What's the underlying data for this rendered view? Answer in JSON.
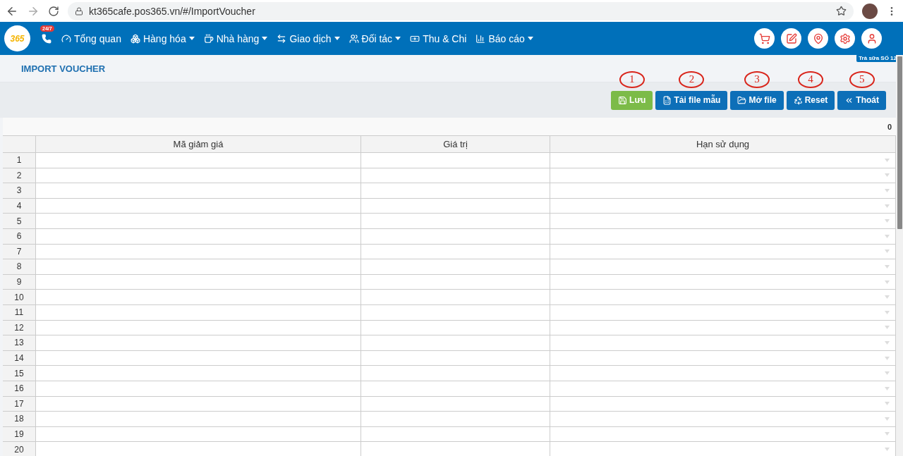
{
  "browser": {
    "url": "kt365cafe.pos365.vn/#/ImportVoucher"
  },
  "navbar": {
    "logo": "365",
    "hotline_badge": "24/7",
    "items": [
      {
        "label": "Tổng quan",
        "dropdown": false
      },
      {
        "label": "Hàng hóa",
        "dropdown": true
      },
      {
        "label": "Nhà hàng",
        "dropdown": true
      },
      {
        "label": "Giao dịch",
        "dropdown": true
      },
      {
        "label": "Đối tác",
        "dropdown": true
      },
      {
        "label": "Thu & Chi",
        "dropdown": false
      },
      {
        "label": "Báo cáo",
        "dropdown": true
      }
    ],
    "branch": "Trà sữa SỐ 12"
  },
  "page_title": "IMPORT VOUCHER",
  "actions": [
    {
      "marker": "1",
      "label": "Lưu",
      "kind": "save"
    },
    {
      "marker": "2",
      "label": "Tải file mẫu",
      "kind": "primary"
    },
    {
      "marker": "3",
      "label": "Mở file",
      "kind": "primary"
    },
    {
      "marker": "4",
      "label": "Reset",
      "kind": "primary"
    },
    {
      "marker": "5",
      "label": "Thoát",
      "kind": "primary"
    }
  ],
  "table": {
    "count": "0",
    "columns": [
      "Mã giảm giá",
      "Giá trị",
      "Hạn sử dụng"
    ],
    "rows": [
      "1",
      "2",
      "3",
      "4",
      "5",
      "6",
      "7",
      "8",
      "9",
      "10",
      "11",
      "12",
      "13",
      "14",
      "15",
      "16",
      "17",
      "18",
      "19",
      "20"
    ]
  }
}
